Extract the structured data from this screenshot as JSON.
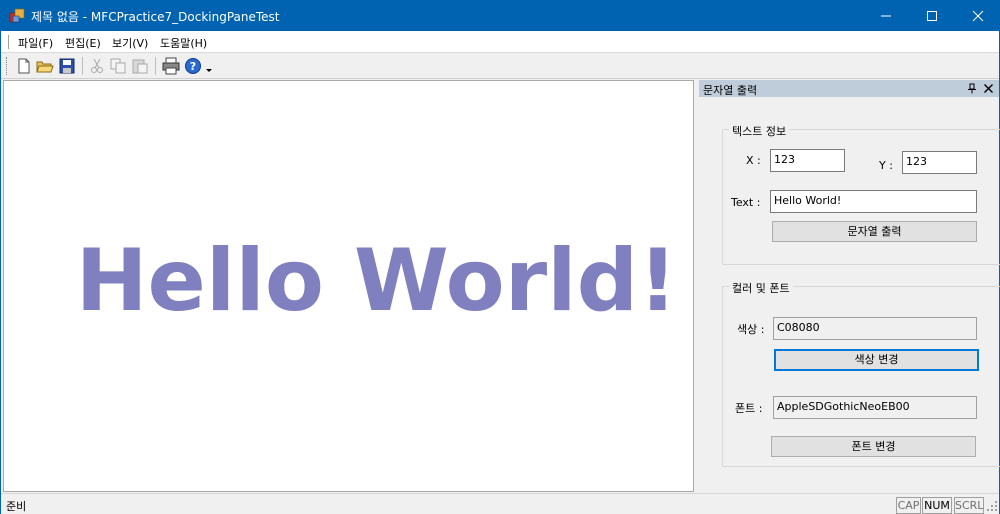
{
  "window": {
    "title": "제목 없음 - MFCPractice7_DockingPaneTest"
  },
  "menu": [
    {
      "label": "파일(F)"
    },
    {
      "label": "편집(E)"
    },
    {
      "label": "보기(V)"
    },
    {
      "label": "도움말(H)"
    }
  ],
  "toolbar": {
    "buttons": [
      "new-icon",
      "open-icon",
      "save-icon",
      "cut-icon",
      "copy-icon",
      "paste-icon",
      "print-icon",
      "help-icon"
    ]
  },
  "view": {
    "text": "Hello World!",
    "text_color": "#8080c0"
  },
  "pane": {
    "title": "문자열 출력",
    "text_group": {
      "title": "텍스트 정보",
      "x_label": "X :",
      "x_value": "123",
      "y_label": "Y :",
      "y_value": "123",
      "text_label": "Text :",
      "text_value": "Hello World!",
      "print_button": "문자열 출력"
    },
    "color_group": {
      "title": "컬러 및 폰트",
      "color_label": "색상 :",
      "color_value": "C08080",
      "color_button": "색상 변경",
      "font_label": "폰트 :",
      "font_value": "AppleSDGothicNeoEB00",
      "font_button": "폰트 변경"
    }
  },
  "status": {
    "text": "준비",
    "indicators": [
      "CAP",
      "NUM",
      "SCRL"
    ]
  },
  "colors": {
    "titlebar": "#0063b1",
    "pane_caption": "#bfcddb",
    "focus": "#0078d7"
  }
}
